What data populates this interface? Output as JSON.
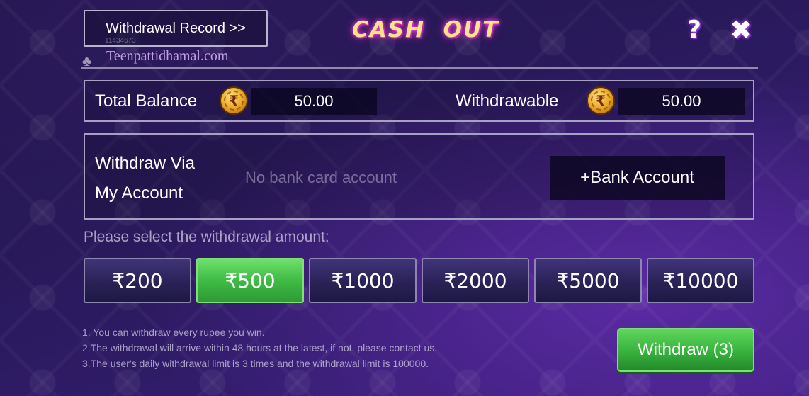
{
  "header": {
    "record_label": "Withdrawal Record >>",
    "title": "CASH  OUT",
    "help_glyph": "?",
    "close_glyph": "✖",
    "watermark_id": "11434673",
    "watermark": "Teenpattidhamal.com",
    "club_glyph": "♣"
  },
  "balance": {
    "total_label": "Total Balance",
    "total_value": "50.00",
    "withdrawable_label": "Withdrawable",
    "withdrawable_value": "50.00",
    "coin_glyph": "₹"
  },
  "account": {
    "via_line1": "Withdraw Via",
    "via_line2": "My Account",
    "no_card_text": "No bank card account",
    "add_bank_label": "+Bank Account"
  },
  "amounts": {
    "prompt": "Please select the withdrawal amount:",
    "options": [
      "₹200",
      "₹500",
      "₹1000",
      "₹2000",
      "₹5000",
      "₹10000"
    ],
    "selected_index": 1
  },
  "notes": [
    "1. You can withdraw every rupee you win.",
    "2.The withdrawal will arrive within 48 hours at the latest, if not, please contact us.",
    "3.The user's daily withdrawal limit is 3 times and the withdrawal limit is 100000."
  ],
  "withdraw_button": "Withdraw (3)",
  "colors": {
    "accent_green": "#3fbb45",
    "title_gold": "#ffe38a",
    "background": "#2a1a5e"
  }
}
